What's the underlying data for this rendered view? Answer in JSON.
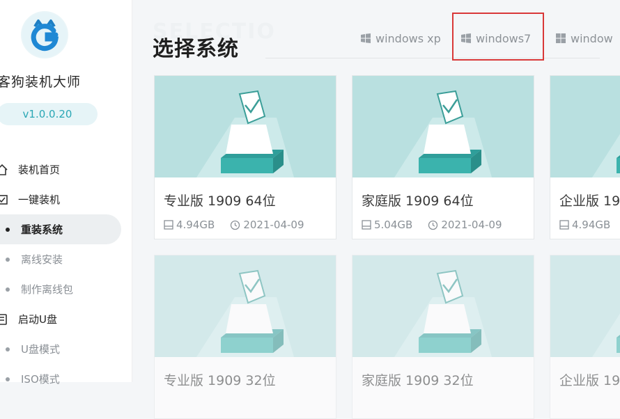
{
  "sidebar": {
    "app_title": "客狗装机大师",
    "version": "v1.0.0.20",
    "items": [
      {
        "label": "装机首页",
        "type": "main",
        "icon": "home-icon"
      },
      {
        "label": "一键装机",
        "type": "main",
        "icon": "install-icon"
      },
      {
        "label": "重装系统",
        "type": "sub",
        "active": true
      },
      {
        "label": "离线安装",
        "type": "sub"
      },
      {
        "label": "制作离线包",
        "type": "sub"
      },
      {
        "label": "启动U盘",
        "type": "main",
        "icon": "usb-icon"
      },
      {
        "label": "U盘模式",
        "type": "sub"
      },
      {
        "label": "ISO模式",
        "type": "sub"
      }
    ]
  },
  "main": {
    "watermark": "SELECTIO",
    "title": "选择系统",
    "tabs": [
      {
        "label": "windows xp"
      },
      {
        "label": "windows7",
        "highlighted": true
      },
      {
        "label": "window"
      }
    ],
    "cards": [
      {
        "name": "专业版 1909 64位",
        "size": "4.94GB",
        "date": "2021-04-09"
      },
      {
        "name": "家庭版 1909 64位",
        "size": "5.04GB",
        "date": "2021-04-09"
      },
      {
        "name": "企业版 19",
        "size": "4.94GB",
        "date": ""
      },
      {
        "name": "专业版 1909 32位",
        "size": "",
        "date": ""
      },
      {
        "name": "家庭版 1909 32位",
        "size": "",
        "date": ""
      },
      {
        "name": "企业版 19",
        "size": "",
        "date": ""
      }
    ]
  },
  "colors": {
    "accent": "#2aa7b5",
    "highlight": "#d93838",
    "thumb_bg": "#b9e0e0"
  }
}
